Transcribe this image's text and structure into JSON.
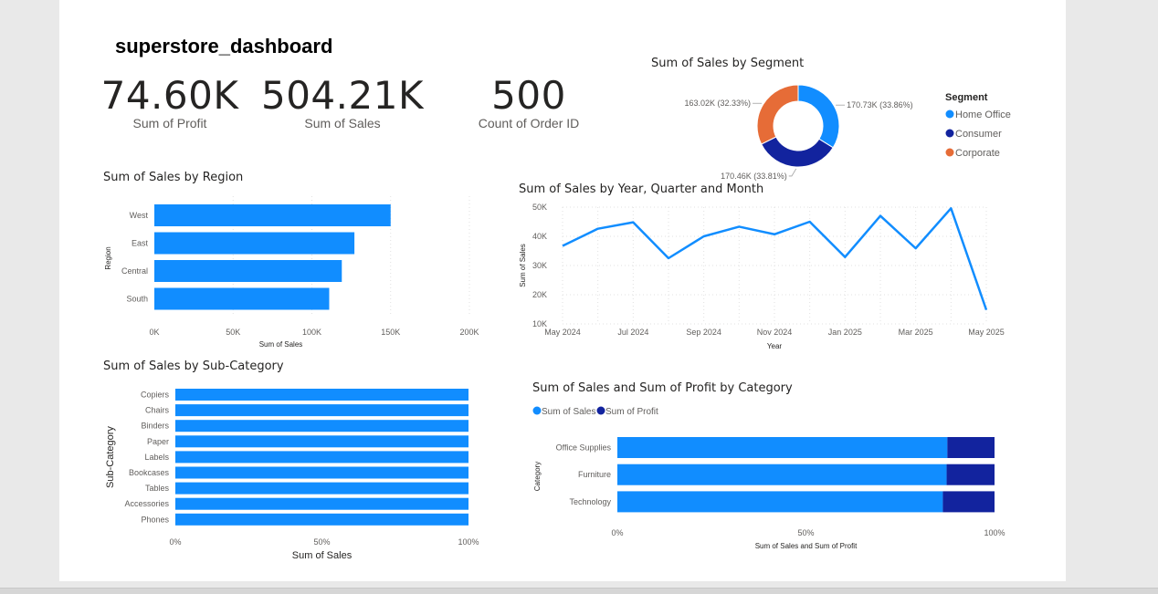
{
  "page_title": "superstore_dashboard",
  "kpis": [
    {
      "value": "74.60K",
      "label": "Sum of Profit"
    },
    {
      "value": "504.21K",
      "label": "Sum of Sales"
    },
    {
      "value": "500",
      "label": "Count of Order ID"
    }
  ],
  "colors": {
    "blue": "#118dff",
    "dark_blue": "#12239e",
    "orange": "#e66c37",
    "grid": "#e1e1e1",
    "text": "#605e5c"
  },
  "chart_data": [
    {
      "id": "segment",
      "type": "pie",
      "title": "Sum of Sales by Segment",
      "legend_title": "Segment",
      "legend_position": "right",
      "slices": [
        {
          "name": "Home Office",
          "value": 170.73,
          "label": "170.73K (33.86%)",
          "color": "#118dff"
        },
        {
          "name": "Consumer",
          "value": 170.46,
          "label": "170.46K (33.81%)",
          "color": "#12239e"
        },
        {
          "name": "Corporate",
          "value": 163.02,
          "label": "163.02K (32.33%)",
          "color": "#e66c37"
        }
      ]
    },
    {
      "id": "region",
      "type": "bar",
      "title": "Sum of Sales by Region",
      "xlabel": "Sum of Sales",
      "ylabel": "Region",
      "categories": [
        "West",
        "East",
        "Central",
        "South"
      ],
      "values": [
        150000,
        127000,
        119000,
        111000
      ],
      "xlim": [
        0,
        200000
      ],
      "ticks": [
        0,
        50000,
        100000,
        150000,
        200000
      ],
      "tick_labels": [
        "0K",
        "50K",
        "100K",
        "150K",
        "200K"
      ],
      "grid": true
    },
    {
      "id": "timeline",
      "type": "line",
      "title": "Sum of Sales by Year, Quarter and Month",
      "xlabel": "Year",
      "ylabel": "Sum of Sales",
      "x": [
        "2024-05",
        "2024-06",
        "2024-07",
        "2024-08",
        "2024-09",
        "2024-10",
        "2024-11",
        "2024-12",
        "2025-01",
        "2025-02",
        "2025-03",
        "2025-04",
        "2025-05"
      ],
      "values": [
        36700,
        42600,
        44800,
        32500,
        40000,
        43300,
        40700,
        45000,
        32900,
        47000,
        35900,
        49600,
        14800
      ],
      "ylim": [
        10000,
        50000
      ],
      "y_ticks": [
        10000,
        20000,
        30000,
        40000,
        50000
      ],
      "y_tick_labels": [
        "10K",
        "20K",
        "30K",
        "40K",
        "50K"
      ],
      "x_tick_labels": [
        "May 2024",
        "Jul 2024",
        "Sep 2024",
        "Nov 2024",
        "Jan 2025",
        "Mar 2025",
        "May 2025"
      ],
      "grid": true
    },
    {
      "id": "subcategory",
      "type": "bar",
      "title": "Sum of Sales by Sub-Category",
      "xlabel": "Sum of Sales",
      "ylabel": "Sub-Category",
      "categories": [
        "Copiers",
        "Chairs",
        "Binders",
        "Paper",
        "Labels",
        "Bookcases",
        "Tables",
        "Accessories",
        "Phones"
      ],
      "values": [
        100,
        100,
        100,
        100,
        100,
        100,
        100,
        100,
        100
      ],
      "xlim": [
        0,
        100
      ],
      "tick_labels": [
        "0%",
        "50%",
        "100%"
      ]
    },
    {
      "id": "category",
      "type": "bar",
      "title": "Sum of Sales and Sum of Profit by Category",
      "xlabel": "Sum of Sales and Sum of Profit",
      "ylabel": "Category",
      "legend_position": "top-left",
      "categories": [
        "Office Supplies",
        "Furniture",
        "Technology"
      ],
      "series": [
        {
          "name": "Sum of Sales",
          "values": [
            87.5,
            87.3,
            86.3
          ],
          "color": "#118dff"
        },
        {
          "name": "Sum of Profit",
          "values": [
            12.5,
            12.7,
            13.7
          ],
          "color": "#12239e"
        }
      ],
      "xlim": [
        0,
        100
      ],
      "tick_labels": [
        "0%",
        "50%",
        "100%"
      ]
    }
  ]
}
